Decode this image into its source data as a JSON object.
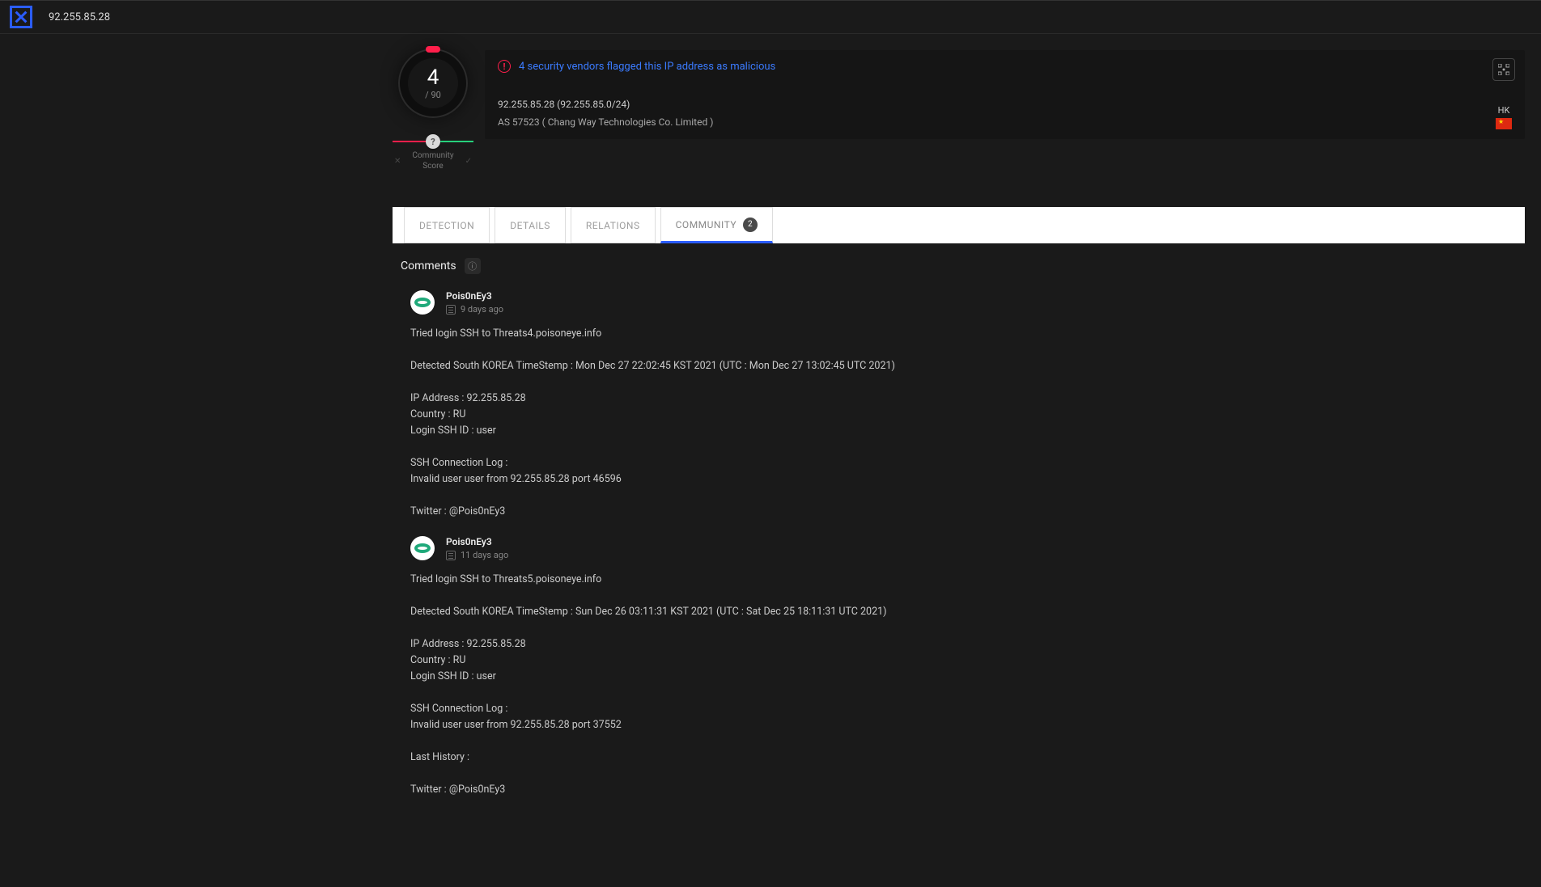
{
  "topbar": {
    "title": "92.255.85.28"
  },
  "score": {
    "value": "4",
    "denom": "/ 90",
    "label_top": "Community",
    "label_bottom": "Score",
    "knob": "?"
  },
  "banner": {
    "title": "4 security vendors flagged this IP address as malicious",
    "line1": "92.255.85.28  (92.255.85.0/24)",
    "line2": "AS 57523 ( Chang Way Technologies Co. Limited )",
    "cc": "HK"
  },
  "tabs": {
    "detection": "DETECTION",
    "details": "DETAILS",
    "relations": "RELATIONS",
    "community": "COMMUNITY",
    "community_count": "2"
  },
  "section": {
    "title": "Comments"
  },
  "comments": [
    {
      "author": "Pois0nEy3",
      "time": "9 days ago",
      "body": "Tried login SSH to Threats4.poisoneye.info\n\nDetected South KOREA TimeStemp : Mon Dec 27 22:02:45 KST 2021 (UTC : Mon Dec 27 13:02:45 UTC 2021)\n\nIP Address : 92.255.85.28\nCountry : RU\nLogin SSH ID : user\n\nSSH Connection Log :\nInvalid user user from 92.255.85.28 port 46596\n\nTwitter : @Pois0nEy3"
    },
    {
      "author": "Pois0nEy3",
      "time": "11 days ago",
      "body": "Tried login SSH to Threats5.poisoneye.info\n\nDetected South KOREA TimeStemp : Sun Dec 26 03:11:31 KST 2021 (UTC : Sat Dec 25 18:11:31 UTC 2021)\n\nIP Address : 92.255.85.28\nCountry : RU\nLogin SSH ID : user\n\nSSH Connection Log :\nInvalid user user from 92.255.85.28 port 37552\n\nLast History :\n\nTwitter : @Pois0nEy3"
    }
  ]
}
